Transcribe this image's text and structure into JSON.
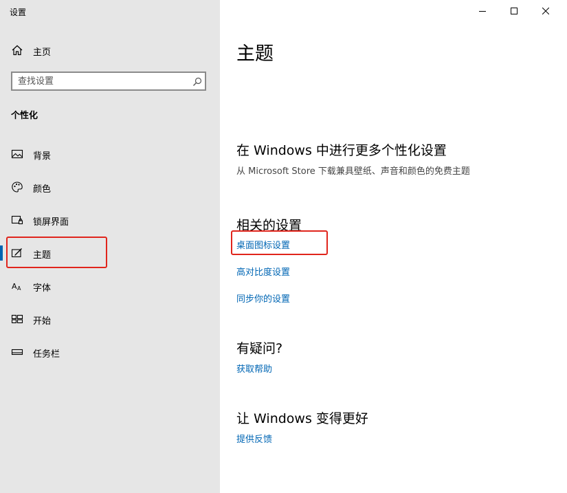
{
  "window": {
    "title": "设置"
  },
  "sidebar": {
    "home_label": "主页",
    "search": {
      "placeholder": "查找设置",
      "value": ""
    },
    "section_title": "个性化",
    "items": [
      {
        "label": "背景",
        "icon": "picture-icon"
      },
      {
        "label": "颜色",
        "icon": "palette-icon"
      },
      {
        "label": "锁屏界面",
        "icon": "lock-screen-icon"
      },
      {
        "label": "主题",
        "icon": "theme-icon",
        "selected": true
      },
      {
        "label": "字体",
        "icon": "font-icon"
      },
      {
        "label": "开始",
        "icon": "start-icon"
      },
      {
        "label": "任务栏",
        "icon": "taskbar-icon"
      }
    ]
  },
  "main": {
    "title": "主题",
    "more_section": {
      "heading": "在 Windows 中进行更多个性化设置",
      "description": "从 Microsoft Store 下载兼具壁纸、声音和颜色的免费主题"
    },
    "related": {
      "heading": "相关的设置",
      "links": [
        "桌面图标设置",
        "高对比度设置",
        "同步你的设置"
      ]
    },
    "question": {
      "heading": "有疑问?",
      "link": "获取帮助"
    },
    "improve": {
      "heading": "让 Windows 变得更好",
      "link": "提供反馈"
    }
  },
  "colors": {
    "accent": "#0063b1",
    "link": "#0066b4",
    "highlight": "#e0241b",
    "sidebar_bg": "#e6e6e6"
  }
}
